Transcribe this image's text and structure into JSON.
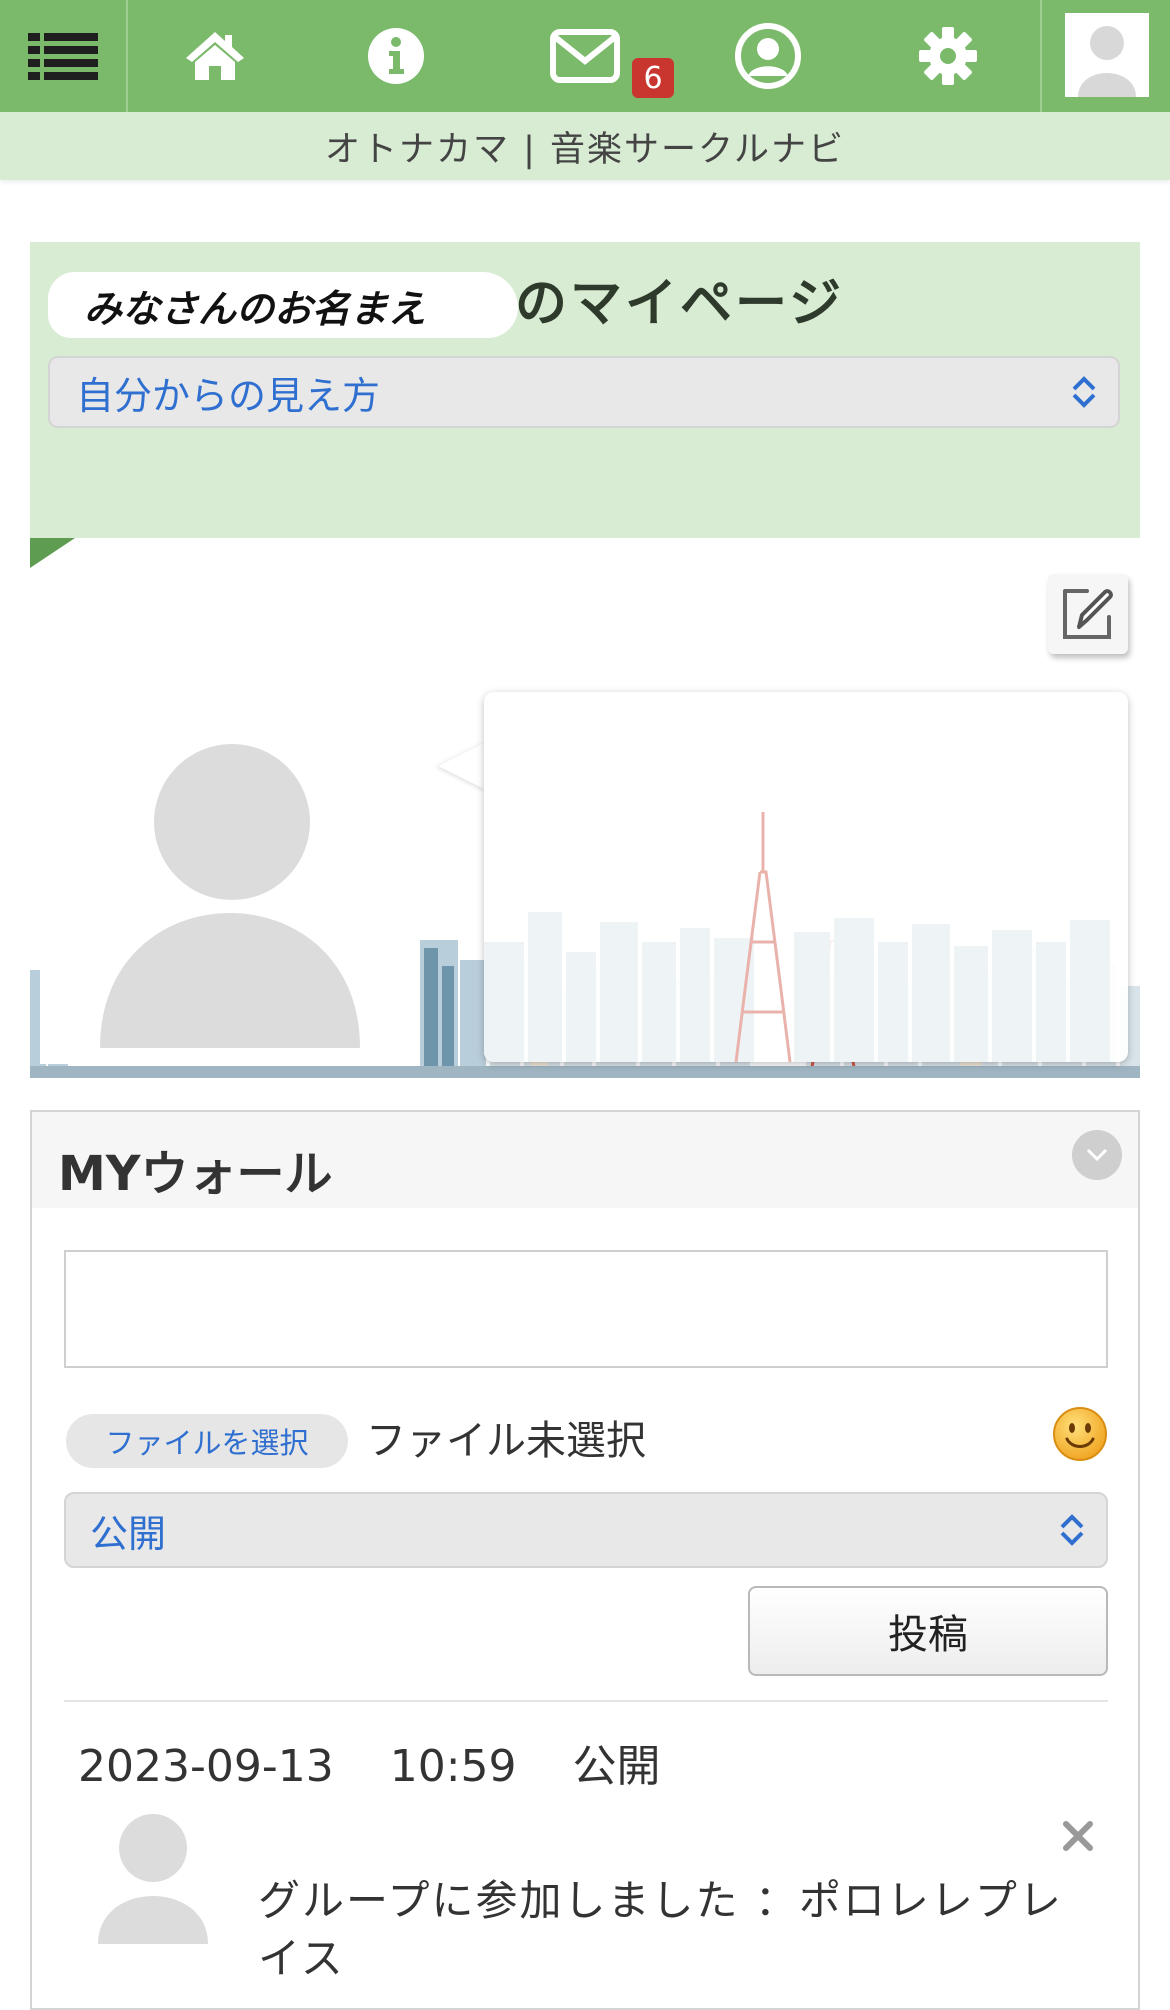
{
  "nav": {
    "items": [
      {
        "name": "menu",
        "icon": "list-menu-icon"
      },
      {
        "name": "home",
        "icon": "home-icon"
      },
      {
        "name": "info",
        "icon": "info-icon"
      },
      {
        "name": "mail",
        "icon": "mail-icon"
      },
      {
        "name": "profile",
        "icon": "user-circle-icon"
      },
      {
        "name": "settings",
        "icon": "gear-icon"
      }
    ],
    "mail_badge": "6",
    "color": "#7aba6a"
  },
  "site": {
    "title": "オトナカマ | 音楽サークルナビ"
  },
  "mypage": {
    "user_name": "みなさんのお名まえ",
    "title_suffix": "のマイページ",
    "view_select": "自分からの見え方"
  },
  "wall": {
    "title": "MYウォール",
    "file_button": "ファイルを選択",
    "file_status": "ファイル未選択",
    "scope_select": "公開",
    "submit_label": "投稿"
  },
  "posts": [
    {
      "date": "2023-09-13",
      "time": "10:59",
      "visibility": "公開",
      "text": "グループに参加しました ：ポロレレプレイス"
    }
  ],
  "colors": {
    "accent_green": "#7aba6a",
    "light_green": "#d8ecd3",
    "link_blue": "#2f6fd0",
    "badge_red": "#c9352f"
  }
}
